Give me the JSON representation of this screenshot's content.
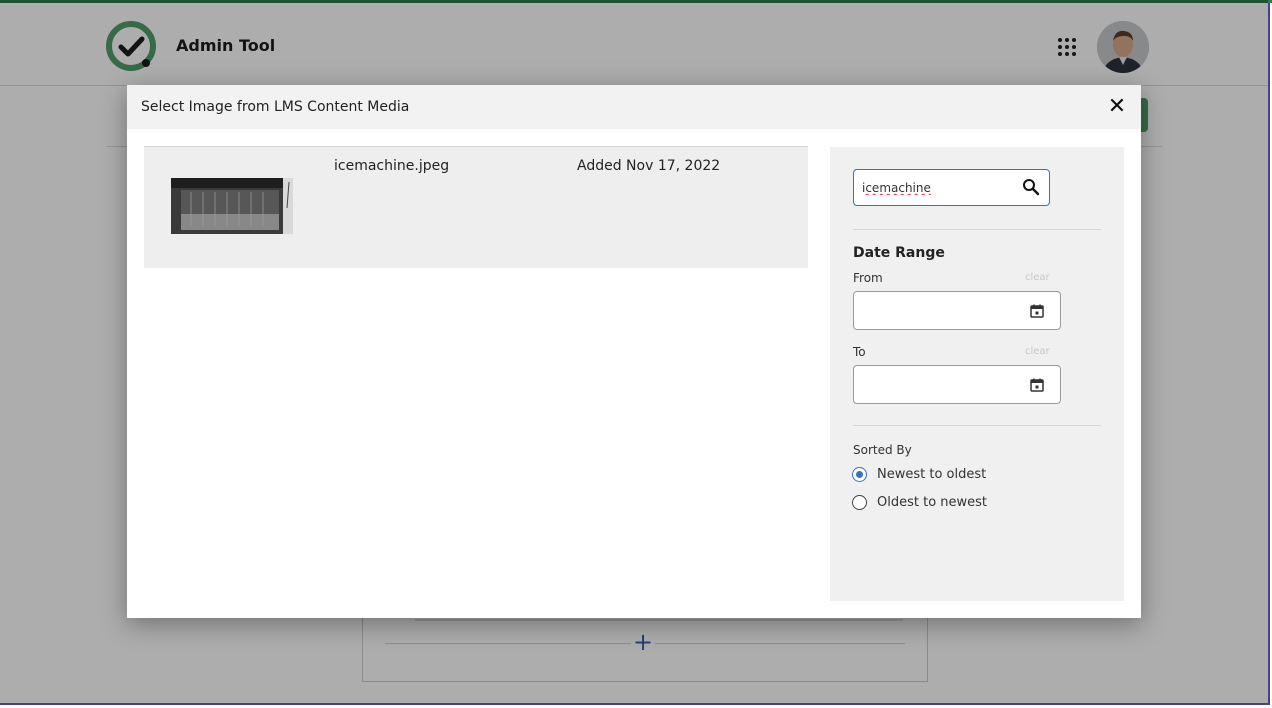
{
  "app": {
    "title": "Admin Tool"
  },
  "modal": {
    "title": "Select Image from LMS Content Media",
    "close_symbol": "✕"
  },
  "results": [
    {
      "filename": "icemachine.jpeg",
      "added": "Added Nov 17, 2022"
    }
  ],
  "filters": {
    "search_value": "icemachine",
    "date_range_title": "Date Range",
    "from_label": "From",
    "to_label": "To",
    "clear_label": "clear",
    "sorted_by_label": "Sorted By",
    "sort_options": [
      "Newest to oldest",
      "Oldest to newest"
    ],
    "selected_sort": "Newest to oldest"
  },
  "background": {
    "plus_symbol": "+"
  },
  "colors": {
    "accent_green": "#2f7d4a",
    "focus_blue": "#3a6fc6"
  },
  "icons": [
    "logo-check-icon",
    "apps-grid-icon",
    "avatar",
    "close-icon",
    "search-icon",
    "calendar-icon",
    "plus-icon"
  ]
}
